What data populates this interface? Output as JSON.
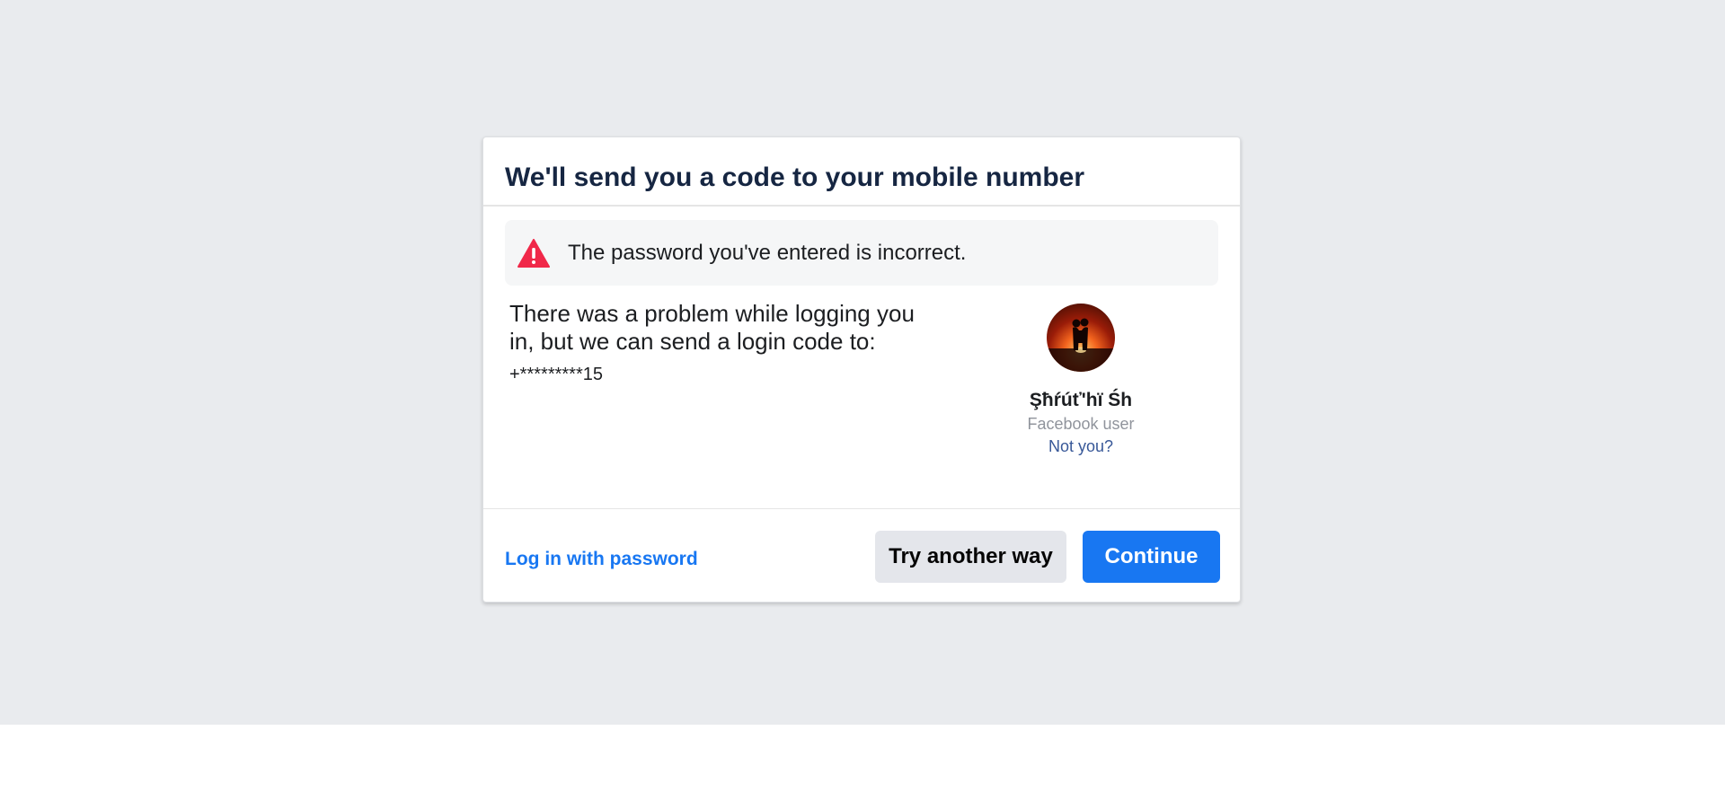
{
  "dialog": {
    "title": "We'll send you a code to your mobile number"
  },
  "error": {
    "icon": "warning-icon",
    "icon_color": "#f02849",
    "text": "The password you've entered is incorrect."
  },
  "body": {
    "message": "There was a problem while logging you in, but we can send a login code to:",
    "phone": "+*********15"
  },
  "profile": {
    "name": "Şħŕúť'hï Śh",
    "subtitle": "Facebook user",
    "not_you": "Not you?"
  },
  "footer": {
    "login_password": "Log in with password",
    "try_another": "Try another way",
    "continue": "Continue"
  },
  "colors": {
    "primary": "#1877f2",
    "link": "#385898",
    "background": "#e9ebee"
  }
}
